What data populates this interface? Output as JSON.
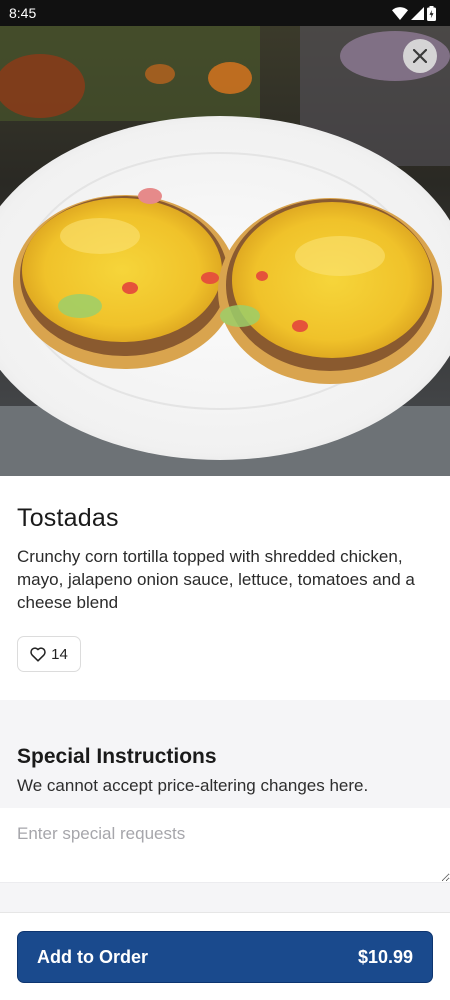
{
  "status_bar": {
    "time": "8:45"
  },
  "item": {
    "name": "Tostadas",
    "description": "Crunchy corn tortilla topped with shredded chicken, mayo, jalapeno onion sauce, lettuce, tomatoes and a cheese blend",
    "likes": "14"
  },
  "special_instructions": {
    "title": "Special Instructions",
    "subtitle": "We cannot accept price-altering changes here.",
    "placeholder": "Enter special requests",
    "value": ""
  },
  "order_button": {
    "label": "Add to Order",
    "price": "$10.99"
  },
  "colors": {
    "accent": "#1a4a8d",
    "status_bar": "#111111",
    "section_gray": "#f5f5f7"
  },
  "icons": [
    "wifi-icon",
    "cell-signal-icon",
    "battery-icon",
    "close-icon",
    "heart-icon"
  ]
}
